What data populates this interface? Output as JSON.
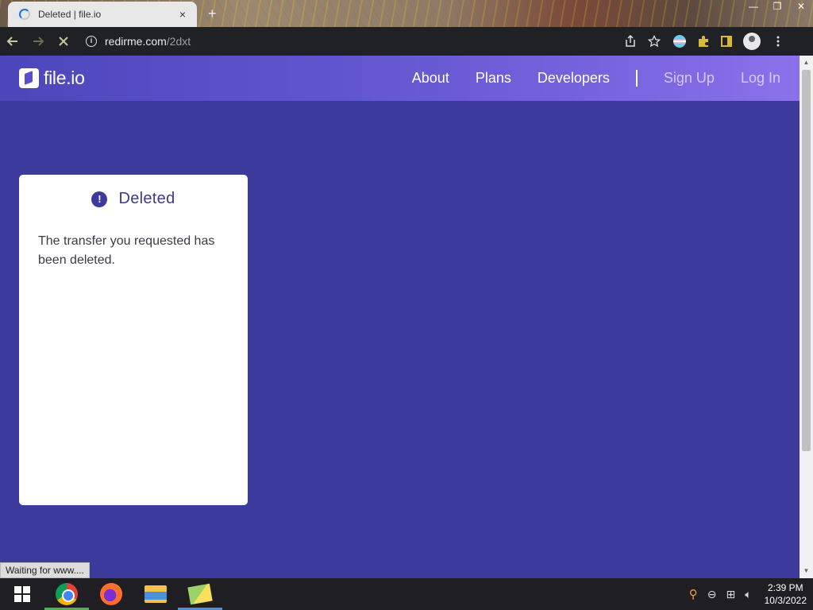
{
  "browser": {
    "tab_title": "Deleted | file.io",
    "tab_close": "×",
    "new_tab": "+",
    "window_controls": [
      "—",
      "❐",
      "✕"
    ],
    "url_host": "redirme.com",
    "url_path": "/2dxt",
    "status_text": "Waiting for www...."
  },
  "site": {
    "logo_text": "file.io",
    "nav": {
      "about": "About",
      "plans": "Plans",
      "developers": "Developers",
      "sign_up": "Sign Up",
      "log_in": "Log In"
    }
  },
  "card": {
    "icon": "!",
    "title": "Deleted",
    "message": "The transfer you requested has been deleted."
  },
  "taskbar": {
    "time": "2:39 PM",
    "date": "10/3/2022"
  },
  "colors": {
    "page_background": "#3d3a9e",
    "header_start": "#4d46ba",
    "header_end": "#8a72ea",
    "card_title": "#3d3a8e"
  }
}
